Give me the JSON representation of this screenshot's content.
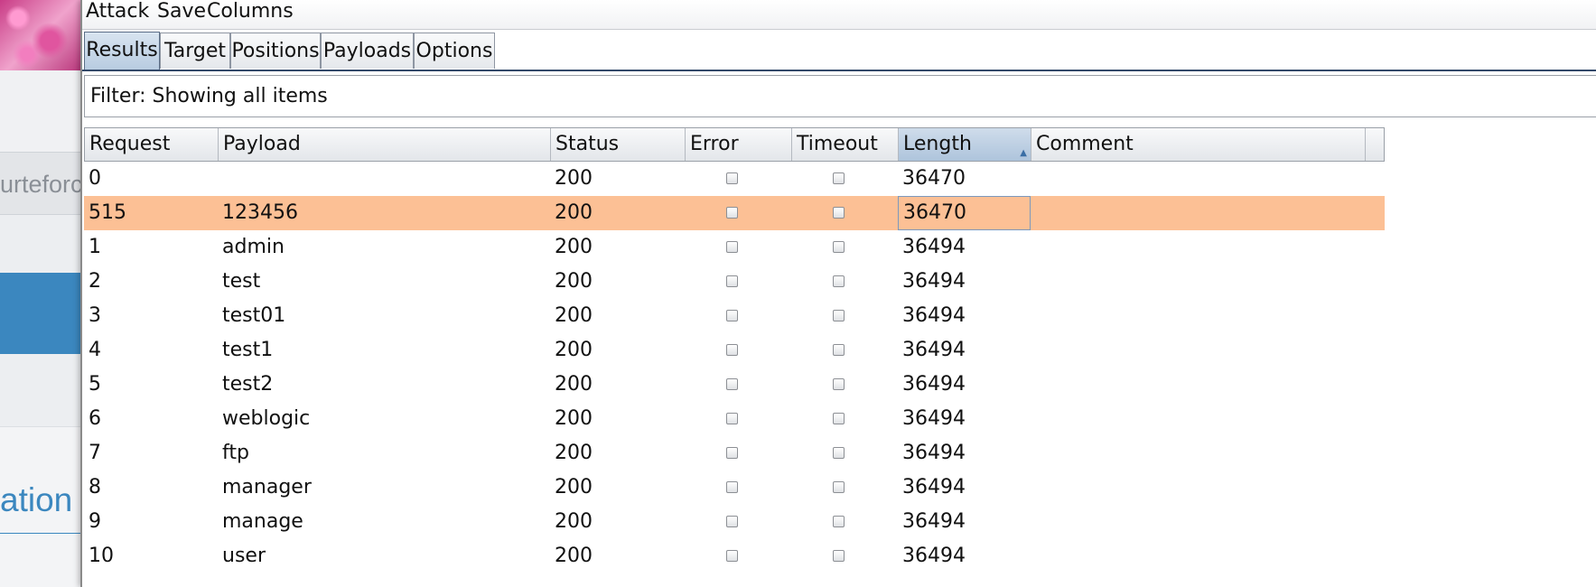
{
  "background": {
    "row_text": "urteforc",
    "bottom_text": "ation"
  },
  "menubar": {
    "items": [
      "Attack",
      "Save",
      "Columns"
    ]
  },
  "tabs": [
    {
      "label": "Results",
      "active": true
    },
    {
      "label": "Target",
      "active": false
    },
    {
      "label": "Positions",
      "active": false
    },
    {
      "label": "Payloads",
      "active": false
    },
    {
      "label": "Options",
      "active": false
    }
  ],
  "filter": {
    "text": "Filter: Showing all items"
  },
  "table": {
    "columns": [
      "Request",
      "Payload",
      "Status",
      "Error",
      "Timeout",
      "Length",
      "Comment"
    ],
    "sorted_column": "Length",
    "sort_indicator": "▲",
    "rows": [
      {
        "request": "0",
        "payload": "",
        "status": "200",
        "error": false,
        "timeout": false,
        "length": "36470",
        "comment": ""
      },
      {
        "request": "515",
        "payload": "123456",
        "status": "200",
        "error": false,
        "timeout": false,
        "length": "36470",
        "comment": "",
        "selected": true
      },
      {
        "request": "1",
        "payload": "admin",
        "status": "200",
        "error": false,
        "timeout": false,
        "length": "36494",
        "comment": ""
      },
      {
        "request": "2",
        "payload": "test",
        "status": "200",
        "error": false,
        "timeout": false,
        "length": "36494",
        "comment": ""
      },
      {
        "request": "3",
        "payload": "test01",
        "status": "200",
        "error": false,
        "timeout": false,
        "length": "36494",
        "comment": ""
      },
      {
        "request": "4",
        "payload": "test1",
        "status": "200",
        "error": false,
        "timeout": false,
        "length": "36494",
        "comment": ""
      },
      {
        "request": "5",
        "payload": "test2",
        "status": "200",
        "error": false,
        "timeout": false,
        "length": "36494",
        "comment": ""
      },
      {
        "request": "6",
        "payload": "weblogic",
        "status": "200",
        "error": false,
        "timeout": false,
        "length": "36494",
        "comment": ""
      },
      {
        "request": "7",
        "payload": "ftp",
        "status": "200",
        "error": false,
        "timeout": false,
        "length": "36494",
        "comment": ""
      },
      {
        "request": "8",
        "payload": "manager",
        "status": "200",
        "error": false,
        "timeout": false,
        "length": "36494",
        "comment": ""
      },
      {
        "request": "9",
        "payload": "manage",
        "status": "200",
        "error": false,
        "timeout": false,
        "length": "36494",
        "comment": ""
      },
      {
        "request": "10",
        "payload": "user",
        "status": "200",
        "error": false,
        "timeout": false,
        "length": "36494",
        "comment": ""
      }
    ]
  },
  "colors": {
    "selected_row": "#fcc095",
    "active_tab": "#b7cbe0",
    "accent_blue": "#3b87bf"
  }
}
